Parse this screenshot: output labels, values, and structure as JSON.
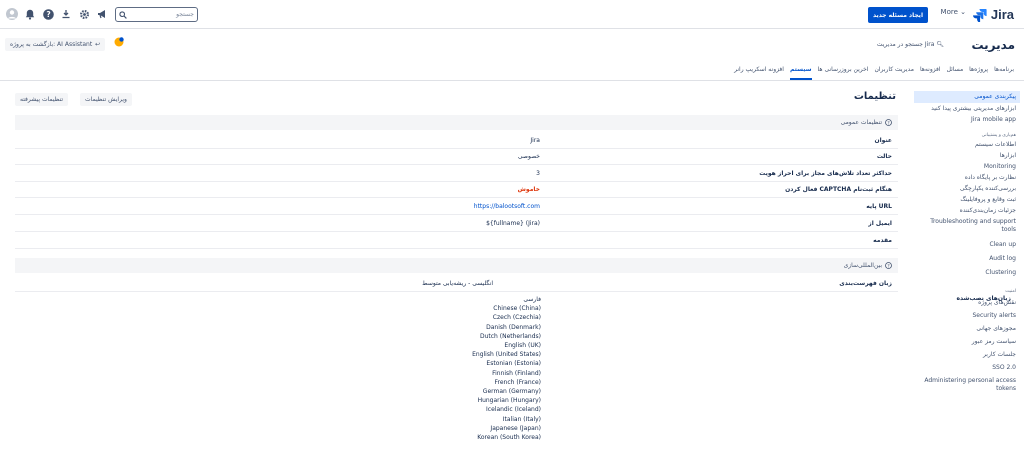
{
  "header": {
    "brand": "Jira",
    "more": "More",
    "create": "ایجاد مسئله جدید",
    "search_placeholder": "جستجو"
  },
  "admin": {
    "title": "مدیریت",
    "search": "جستجو در مدیریت Jira",
    "back_button": "بازگشت به پروژه: AI Assistant"
  },
  "tabs": [
    {
      "label": "برنامه‌ها"
    },
    {
      "label": "پروژه‌ها"
    },
    {
      "label": "مسائل"
    },
    {
      "label": "افزونه‌ها"
    },
    {
      "label": "مدیریت کاربران"
    },
    {
      "label": "اخرین بروزرسانی ها"
    },
    {
      "label": "سیستم"
    },
    {
      "label": "افزونه اسکریپ رانر"
    }
  ],
  "sidebar": {
    "items_top": [
      "پیکربندی عمومی",
      "ابزارهای مدیریتی بیشتری پیدا کنید",
      "Jira mobile app"
    ],
    "head_support": "هم‌یاری و پشتیبانی",
    "items_support": [
      "اطلاعات سیستم",
      "ابزارها",
      "Monitoring",
      "نظارت بر پایگاه داده",
      "بررسی‌کننده یکپارچگی",
      "ثبت وقایع و پروفایلینگ",
      "جزئیات زمان‌بندی‌کننده",
      "Troubleshooting and support tools",
      "Clean up",
      "Audit log",
      "Clustering"
    ],
    "head_security": "امنیت",
    "items_security": [
      "نقش‌های پروژه",
      "Security alerts",
      "مجوزهای جهانی",
      "سیاست رمز عبور",
      "جلسات کاربر",
      "SSO 2.0",
      "Administering personal access tokens"
    ]
  },
  "content": {
    "title": "تنظیمات",
    "edit_button": "ویرایش تنظیمات",
    "advanced_button": "تنظیمات پیشرفته",
    "general_section": "تنظیمات عمومی",
    "general_rows": [
      {
        "label": "عنوان",
        "value": "Jira"
      },
      {
        "label": "حالت",
        "value": "خصوصی"
      },
      {
        "label": "حداکثر تعداد تلاش‌های مجاز برای احراز هویت",
        "value": "3"
      },
      {
        "label": "فعال کردن CAPTCHA هنگام ثبت‌نام",
        "value": "خاموش"
      },
      {
        "label": "پایه URL",
        "value": "https://balootsoft.com"
      },
      {
        "label": "ایمیل از",
        "value": "${fullname} (Jira)"
      },
      {
        "label": "مقدمه",
        "value": ""
      }
    ],
    "i18n_section": "بین‌المللی‌سازی",
    "index_lang_label": "زبان فهرست‌بندی",
    "index_lang_value": "انگلیسی - ریشه‌یابی متوسط",
    "installed_langs_label": "زبان‌های نصب‌شده",
    "installed_langs": [
      "فارسی",
      "Chinese (China)",
      "Czech (Czechia)",
      "Danish (Denmark)",
      "Dutch (Netherlands)",
      "English (UK)",
      "English (United States)",
      "Estonian (Estonia)",
      "Finnish (Finland)",
      "French (France)",
      "German (Germany)",
      "Hungarian (Hungary)",
      "Icelandic (Iceland)",
      "Italian (Italy)",
      "Japanese (Japan)",
      "Korean (South Korea)"
    ]
  },
  "colors": {
    "primary": "#0052cc",
    "danger": "#de350b",
    "selected_bg": "#deebff"
  }
}
